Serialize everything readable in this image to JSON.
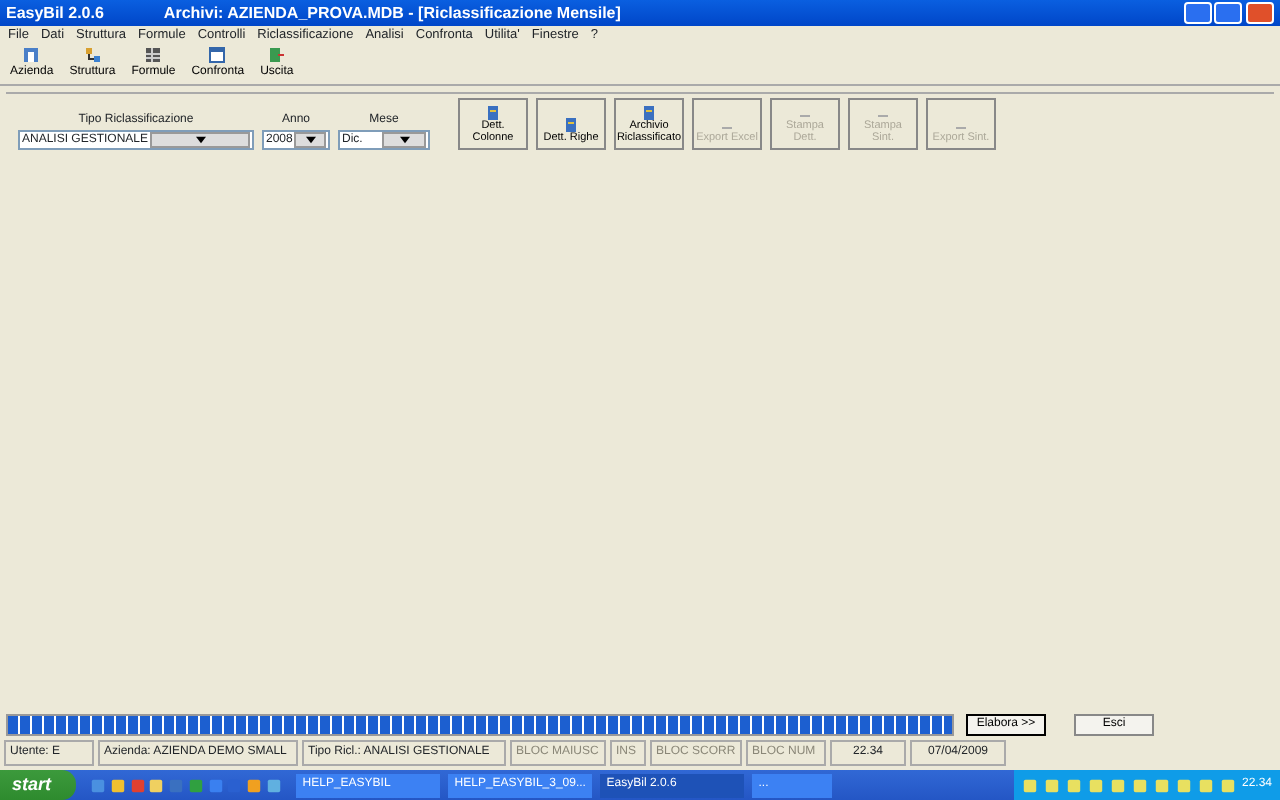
{
  "window": {
    "title": "EasyBil   2.0.6",
    "document_title": "Archivi: AZIENDA_PROVA.MDB - [Riclassificazione Mensile]"
  },
  "menu": [
    "File",
    "Dati",
    "Struttura",
    "Formule",
    "Controlli",
    "Riclassificazione",
    "Analisi",
    "Confronta",
    "Utilita'",
    "Finestre",
    "?"
  ],
  "toolbar": [
    {
      "label": "Azienda",
      "kind": "building"
    },
    {
      "label": "Struttura",
      "kind": "tree"
    },
    {
      "label": "Formule",
      "kind": "grid"
    },
    {
      "label": "Confronta",
      "kind": "window"
    },
    {
      "label": "Uscita",
      "kind": "exit"
    }
  ],
  "filters": [
    {
      "label": "Tipo Riclassificazione",
      "value": "ANALISI GESTIONALE",
      "kind": "wide"
    },
    {
      "label": "Anno",
      "value": "2008",
      "kind": "narrow"
    },
    {
      "label": "Mese",
      "value": "Dic.",
      "kind": "medium"
    }
  ],
  "actions": [
    {
      "label": "Dett. Colonne",
      "disabled": false
    },
    {
      "label": "Dett. Righe",
      "disabled": false
    },
    {
      "label": "Archivio Riclassificato",
      "disabled": false
    },
    {
      "label": "Export Excel",
      "disabled": true
    },
    {
      "label": "Stampa Dett.",
      "disabled": true
    },
    {
      "label": "Stampa Sint.",
      "disabled": true
    },
    {
      "label": "Export Sint.",
      "disabled": true
    }
  ],
  "progress": {
    "level": 1
  },
  "bottom_buttons": [
    {
      "label": "Elabora >>",
      "selected": true
    },
    {
      "label": "Esci",
      "selected": false
    }
  ],
  "status_bar": [
    {
      "text": "Utente: E",
      "disabled": false
    },
    {
      "text": "Azienda: AZIENDA DEMO SMALL",
      "disabled": false
    },
    {
      "text": "Tipo Ricl.: ANALISI GESTIONALE",
      "disabled": false
    },
    {
      "text": "BLOC MAIUSC",
      "disabled": true
    },
    {
      "text": "INS",
      "disabled": true
    },
    {
      "text": "BLOC SCORR",
      "disabled": true
    },
    {
      "text": "BLOC NUM",
      "disabled": true
    },
    {
      "text": "22.34",
      "disabled": false
    },
    {
      "text": "07/04/2009",
      "disabled": false
    }
  ],
  "taskbar": {
    "start": "start",
    "tasks": [
      {
        "label": "HELP_EASYBIL",
        "selected": false
      },
      {
        "label": "HELP_EASYBIL_3_09...",
        "selected": false
      },
      {
        "label": "EasyBil  2.0.6",
        "selected": true
      },
      {
        "label": "...",
        "selected": false
      }
    ],
    "clock": "22.34"
  }
}
